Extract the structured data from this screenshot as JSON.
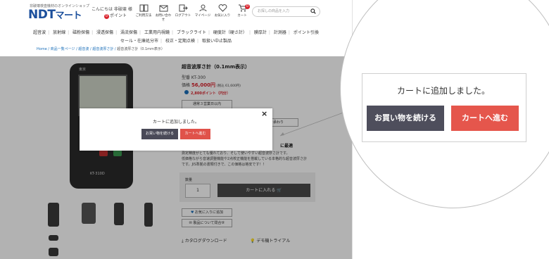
{
  "header": {
    "tagline": "非破壊検査機材のオンラインショップ",
    "logo": "NDT",
    "logo_kana": "マート",
    "greeting": "こんにちは 非破壊 様",
    "points_count": "0",
    "points_label": "ポイント",
    "icons": [
      {
        "label": "ご利用方法",
        "icon": "book-icon"
      },
      {
        "label": "お問い合わせ",
        "icon": "mail-icon"
      },
      {
        "label": "ログアウト",
        "icon": "logout-icon"
      },
      {
        "label": "マイページ",
        "icon": "user-icon"
      },
      {
        "label": "お気に入り",
        "icon": "heart-icon"
      },
      {
        "label": "カート",
        "icon": "cart-icon",
        "badge": "0"
      }
    ],
    "search_placeholder": "お探しの商品を入力"
  },
  "nav": {
    "row1": [
      "超音波",
      "放射線",
      "磁粉探傷",
      "浸透探傷",
      "渦流探傷",
      "工業用内視鏡",
      "ブラックライト",
      "硬度計（硬さ計）",
      "膜厚計",
      "計測器",
      "ポイント引換"
    ],
    "row2": [
      "セール・在庫処分市",
      "校正・定期点検",
      "取扱い中止製品"
    ]
  },
  "breadcrumb": [
    "Home",
    "商品一覧ページ",
    "超音波",
    "超音波厚さ計",
    "超音波厚さ計（0.1mm表示）"
  ],
  "product": {
    "title": "超音波厚さ計（0.1mm表示）",
    "model": "型番 KT-300",
    "price_label": "価格",
    "price": "56,000円",
    "price_tax": "(税込 61,600円)",
    "points": "2,800ポイント（円分）",
    "shipping": "通常３営業日以内",
    "demo": "デモを承わり",
    "description_line1": "測定精度がとても優れており、そして使いやすい超音波厚さ計です。",
    "description_line2": "低価格ながら音速調整機能や2点校正機能を搭載している本格的な超音波厚さ計",
    "description_line3": "です。JIS準拠の書類付きで、この価格は格安です！！",
    "extra_link": "に最適",
    "device_logo": "東京",
    "device_model": "KT-310D",
    "qty_label": "数量",
    "qty_value": "1",
    "add_to_cart": "カートに入れる",
    "favorite": "お気に入りに追加",
    "inquiry": "製品について問合せ",
    "catalog": "カタログダウンロード",
    "trial": "デモ機トライアル"
  },
  "modal": {
    "close": "×",
    "message": "カートに追加しました。",
    "continue_label": "お買い物を続ける",
    "cart_label": "カートへ進む"
  },
  "zoom": {
    "message": "カートに追加しました。",
    "continue_label": "お買い物を続ける",
    "cart_label": "カートへ進む"
  },
  "colors": {
    "brand": "#1b4f9c",
    "accent_red": "#e5564c",
    "dark_button": "#4e4e5c"
  }
}
